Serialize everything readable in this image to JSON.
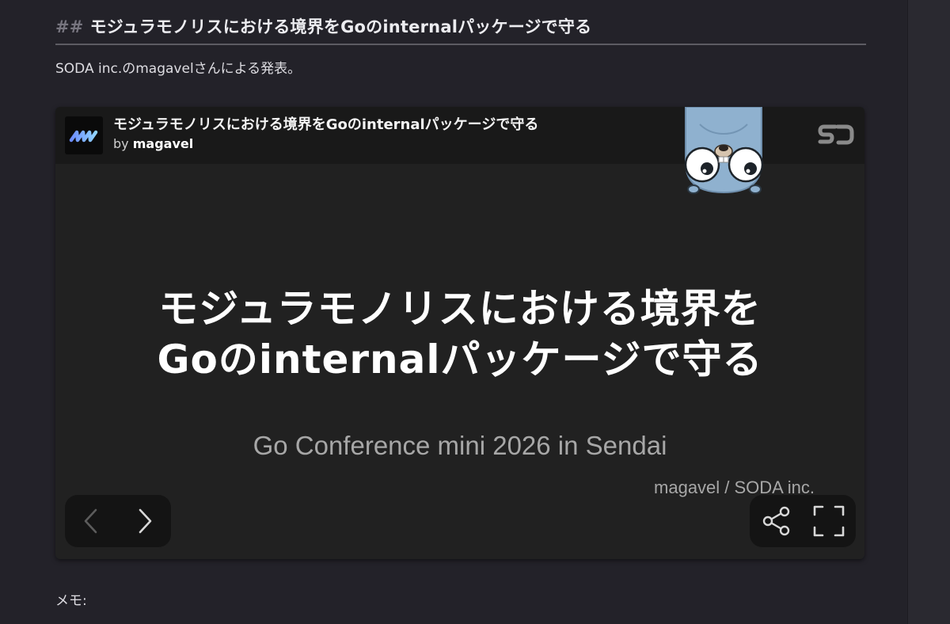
{
  "article": {
    "heading_marker": "##",
    "heading": "モジュラモノリスにおける境界をGoのinternalパッケージで守る",
    "intro": "SODA inc.のmagavelさんによる発表。",
    "memo_label": "メモ:"
  },
  "embed": {
    "deck_title": "モジュラモノリスにおける境界をGoのinternalパッケージで守る",
    "by_prefix": "by",
    "author": "magavel",
    "slide": {
      "title_line1": "モジュラモノリスにおける境界を",
      "title_line2": "Goのinternalパッケージで守る",
      "subtitle": "Go Conference mini 2026 in Sendai",
      "author_line": "magavel / SODA inc."
    },
    "icons": {
      "avatar": "magavel-avatar-icon",
      "brand": "speakerdeck-logo-icon",
      "mascot": "gopher-icon",
      "prev": "chevron-left-icon",
      "next": "chevron-right-icon",
      "share": "share-icon",
      "fullscreen": "fullscreen-icon"
    }
  },
  "colors": {
    "page_background": "#232229",
    "embed_background": "#212121",
    "gopher_body": "#8fb1cf"
  }
}
